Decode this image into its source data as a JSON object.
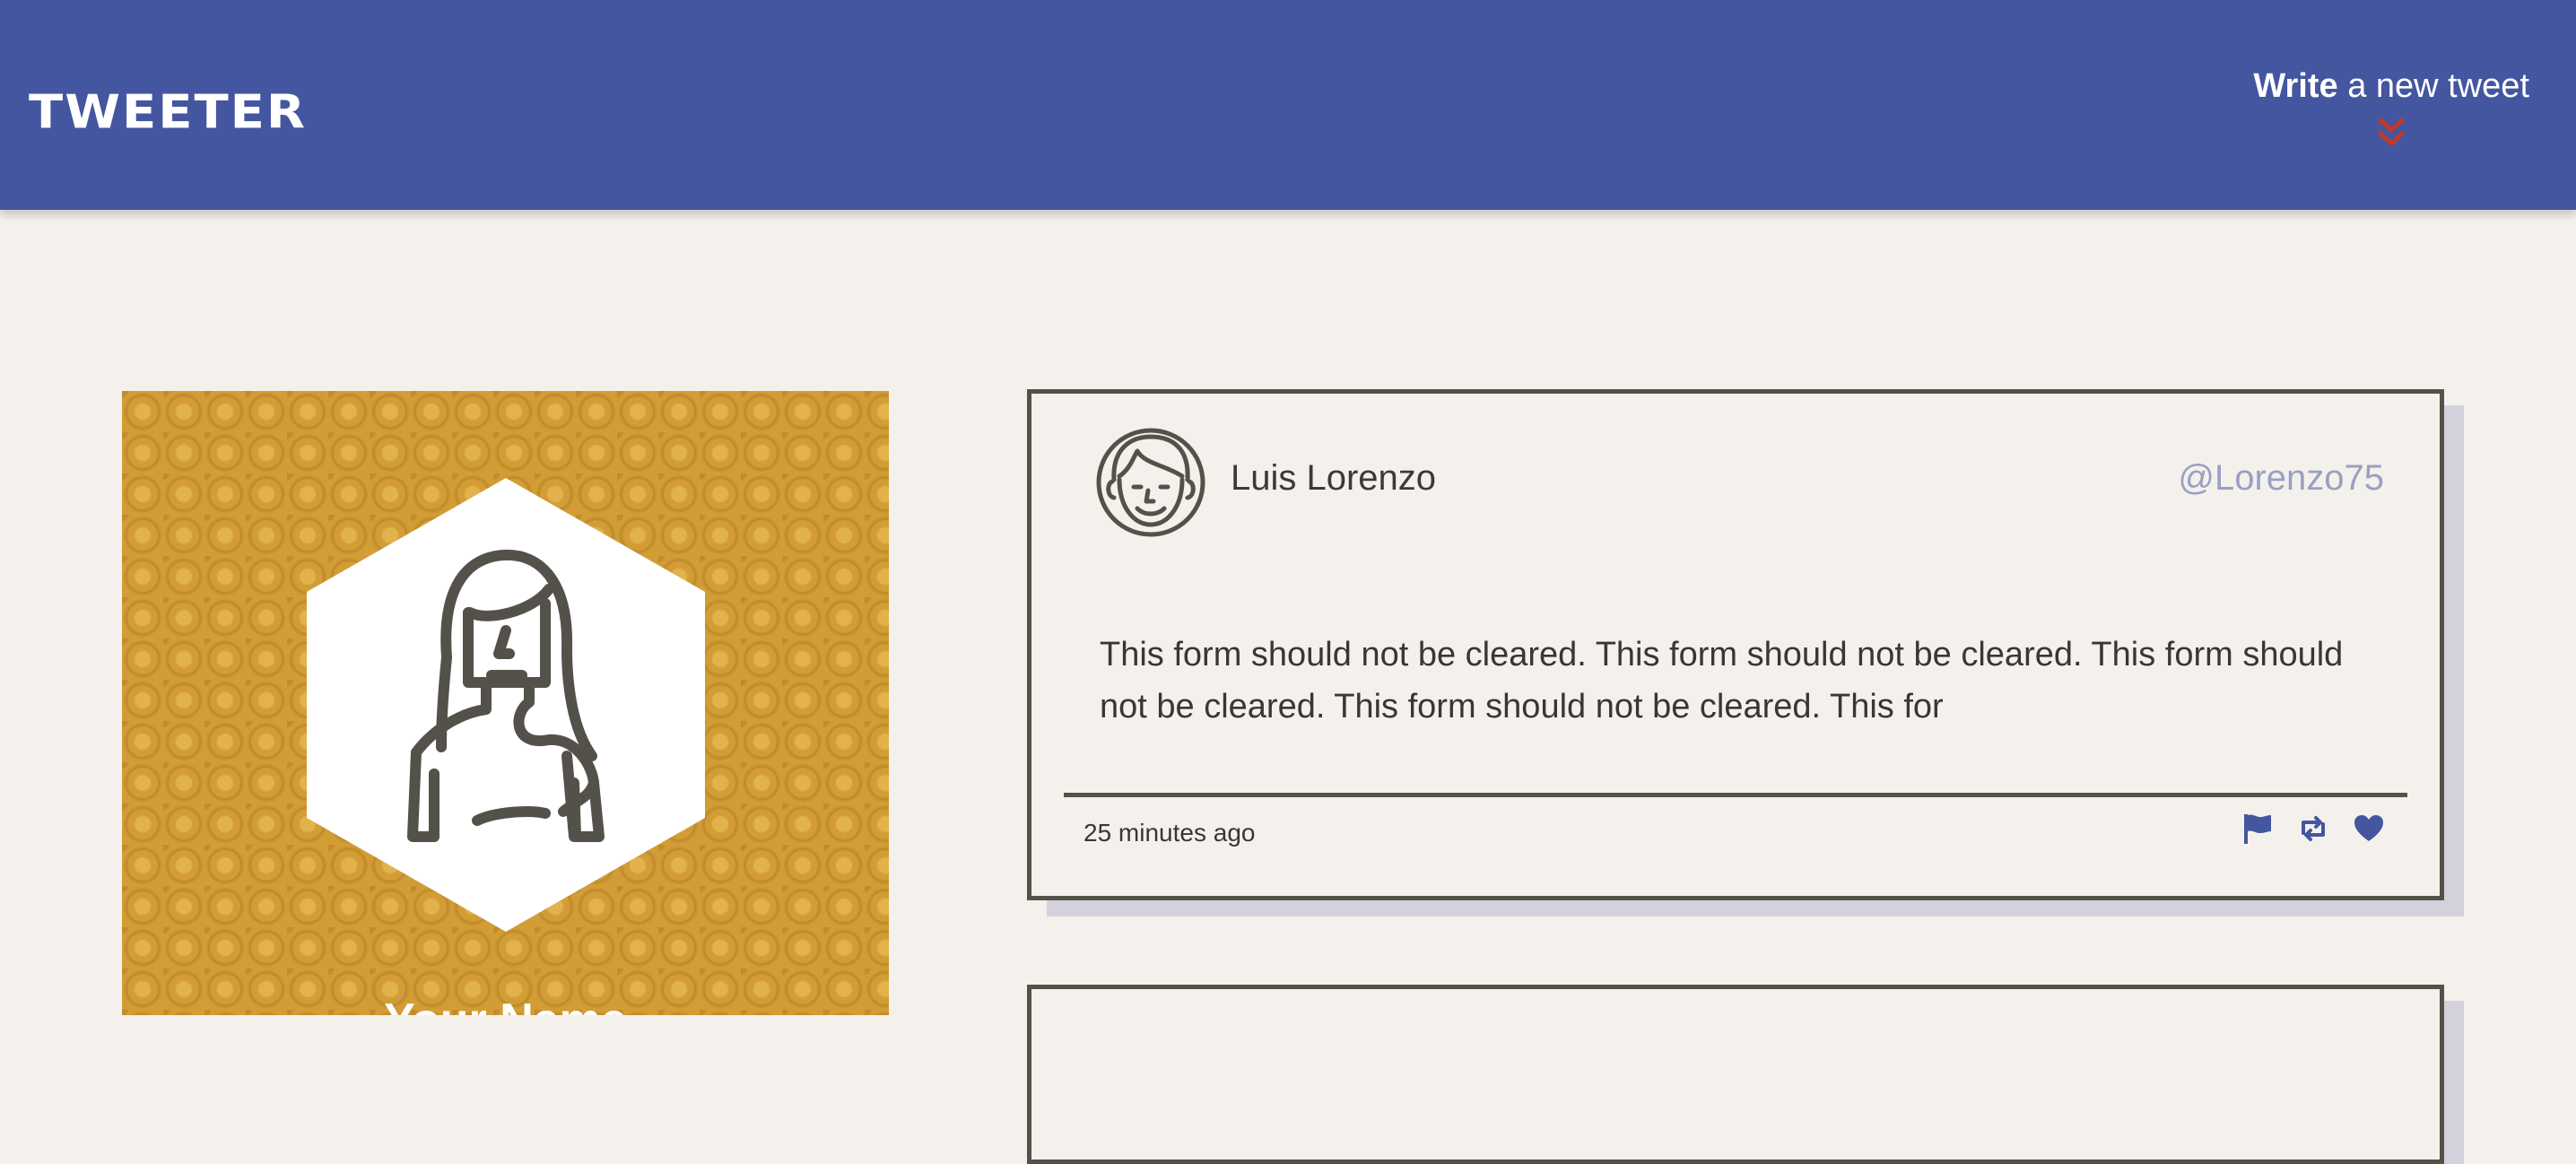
{
  "nav": {
    "brand": "TWEETER",
    "write_bold": "Write",
    "write_rest": " a new tweet",
    "chevron_color": "#c0392b"
  },
  "profile": {
    "name": "Your Name"
  },
  "tweets": [
    {
      "name": "Luis Lorenzo",
      "handle": "@Lorenzo75",
      "content": "This form should not be cleared. This form should not be cleared. This form should not be cleared. This form should not be cleared. This for",
      "time": "25 minutes ago",
      "actions": [
        "flag-icon",
        "retweet-icon",
        "heart-icon"
      ]
    }
  ],
  "colors": {
    "navbar": "#4456a0",
    "profile_bg": "#d39d36",
    "page_bg": "#f4f1ec",
    "handle": "#9aa0c2",
    "accent": "#4456a0"
  }
}
